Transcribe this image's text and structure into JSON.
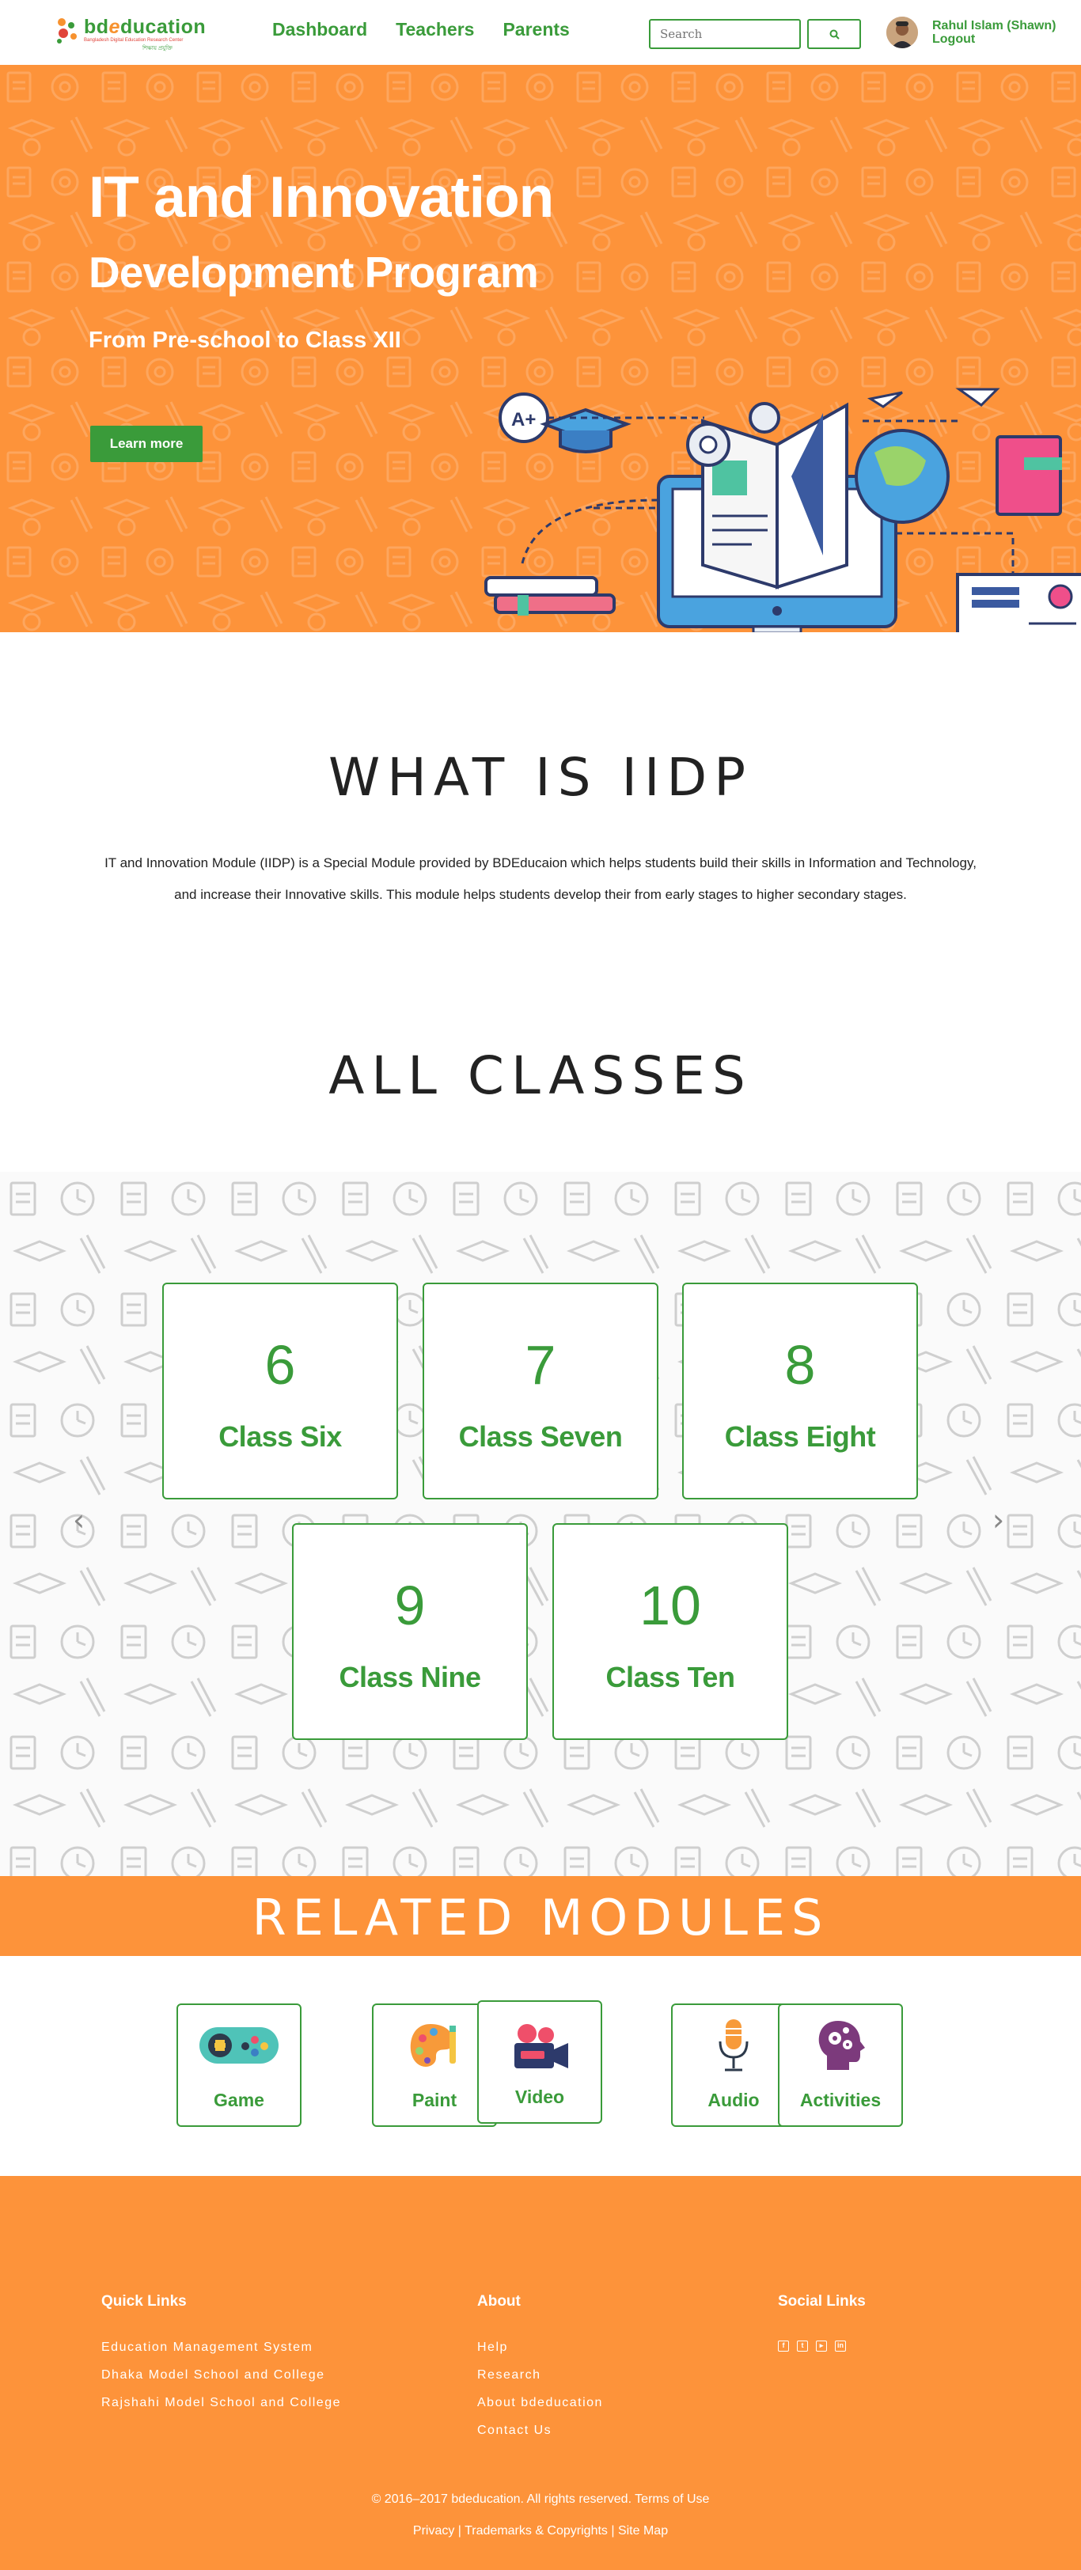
{
  "header": {
    "logo_text_a": "bd",
    "logo_text_e": "e",
    "logo_text_b": "ducation",
    "logo_tagline": "Bangladesh Digital Education Research Center",
    "logo_tagline2": "শিক্ষায় প্রযুক্তি",
    "nav": [
      "Dashboard",
      "Teachers",
      "Parents"
    ],
    "search_placeholder": "Search",
    "user_name": "Rahul Islam (Shawn)",
    "logout": "Logout"
  },
  "hero": {
    "title": "IT and Innovation",
    "subtitle": "Development Program",
    "description": "From Pre-school to Class XII",
    "button": "Learn more"
  },
  "what_is": {
    "heading": "WHAT IS IIDP",
    "body": "IT and Innovation Module (IIDP) is a Special Module provided by BDEducaion which helps students build their skills in Information and Technology, and increase their Innovative skills. This module helps students develop their from early stages to higher secondary stages."
  },
  "classes": {
    "heading": "ALL CLASSES",
    "items": [
      {
        "number": "6",
        "name": "Class Six"
      },
      {
        "number": "7",
        "name": "Class Seven"
      },
      {
        "number": "8",
        "name": "Class Eight"
      },
      {
        "number": "9",
        "name": "Class Nine"
      },
      {
        "number": "10",
        "name": "Class Ten"
      }
    ],
    "prev": "‹",
    "next": "›"
  },
  "related": {
    "heading": "RELATED MODULES",
    "items": [
      {
        "label": "Game",
        "icon": "gamepad-icon"
      },
      {
        "label": "Paint",
        "icon": "palette-icon"
      },
      {
        "label": "Video",
        "icon": "video-camera-icon"
      },
      {
        "label": "Audio",
        "icon": "microphone-icon"
      },
      {
        "label": "Activities",
        "icon": "brain-gears-icon"
      }
    ]
  },
  "footer": {
    "quick_links": {
      "title": "Quick Links",
      "items": [
        "Education Management System",
        "Dhaka Model School and College",
        "Rajshahi Model School and College"
      ]
    },
    "about": {
      "title": "About",
      "items": [
        "Help",
        "Research",
        "About bdeducation",
        "Contact Us"
      ]
    },
    "social": {
      "title": "Social Links",
      "icons": [
        "facebook-icon",
        "twitter-icon",
        "youtube-icon",
        "linkedin-icon"
      ]
    },
    "copyright": "© 2016–2017 bdeducation. All rights reserved. Terms of Use",
    "links": [
      "Privacy",
      "Trademarks & Copyrights",
      "Site Map"
    ]
  },
  "colors": {
    "brand_green": "#3a9b3a",
    "brand_orange": "#fd933a"
  }
}
